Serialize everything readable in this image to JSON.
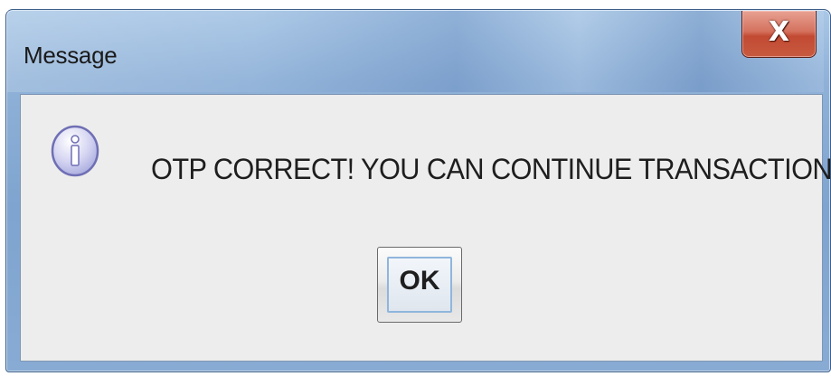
{
  "window": {
    "title": "Message",
    "close_glyph": "X"
  },
  "dialog": {
    "icon": "info-icon",
    "message": "OTP CORRECT! YOU CAN CONTINUE TRANSACTION",
    "ok_label": "OK"
  },
  "colors": {
    "titlebar": "#8fb1d8",
    "close_button": "#c24a33",
    "content_bg": "#ededed",
    "info_icon_fill": "#d5d5f2",
    "info_icon_border": "#6f6fb5"
  }
}
